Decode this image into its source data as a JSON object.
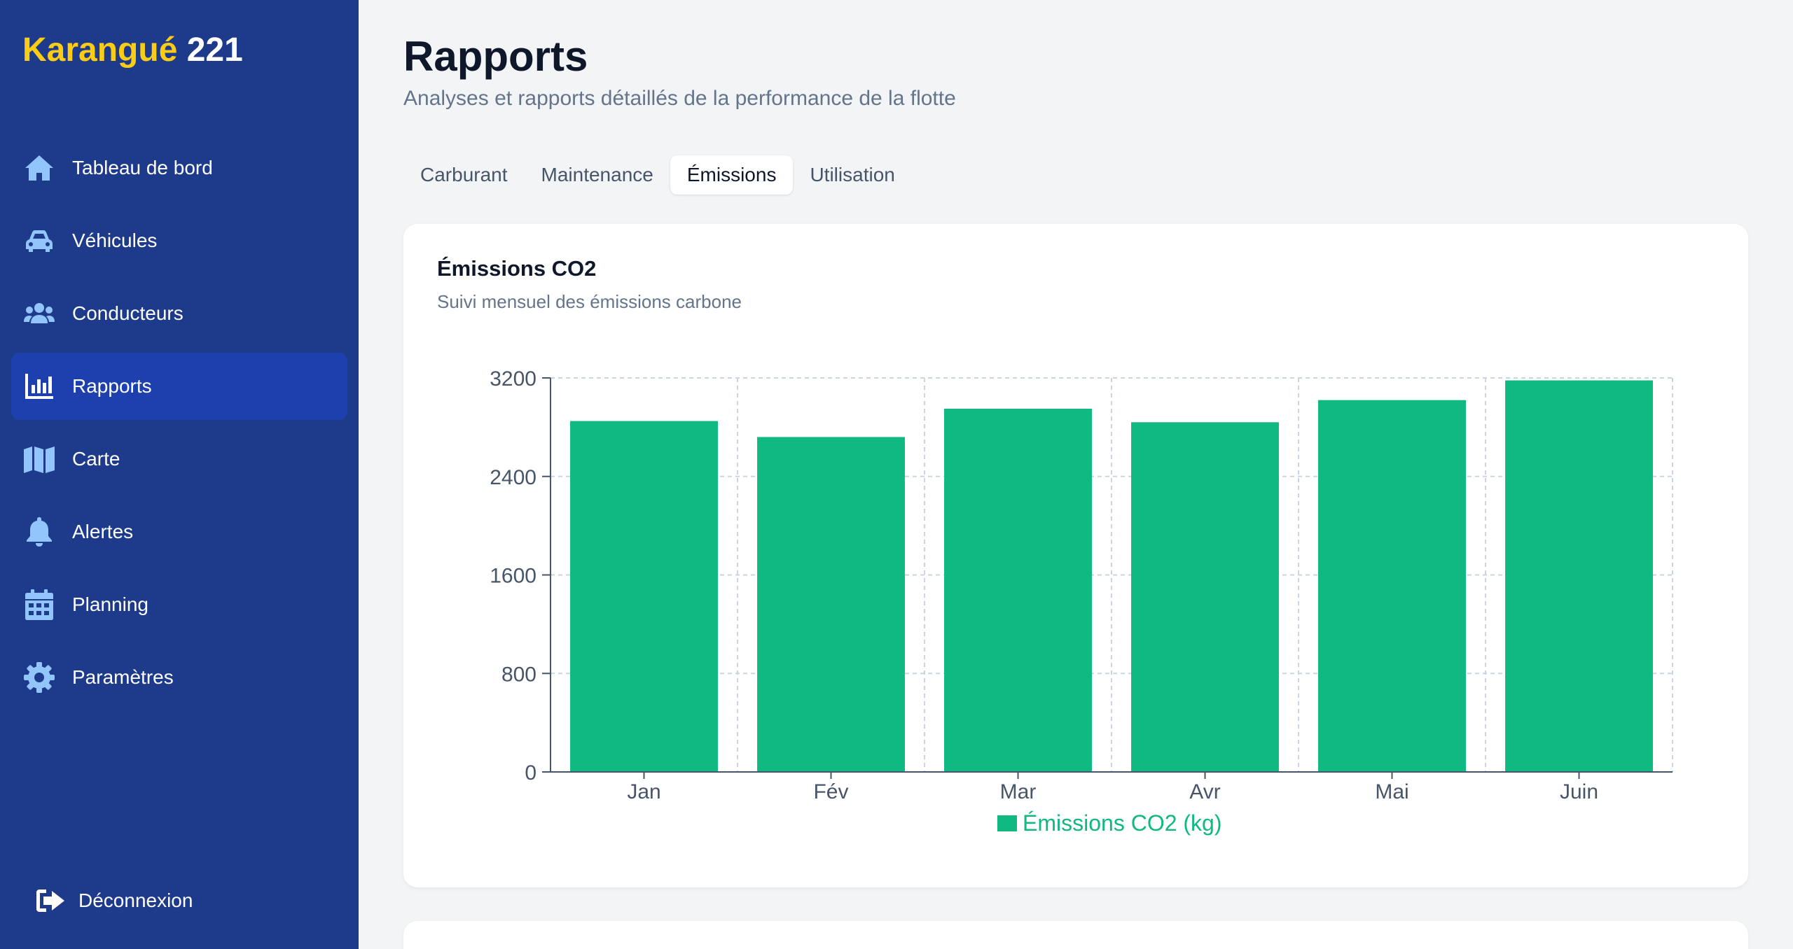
{
  "brand": {
    "part1": "Karangué",
    "part2": "221"
  },
  "sidebar": {
    "items": [
      {
        "label": "Tableau de bord",
        "icon": "home-icon"
      },
      {
        "label": "Véhicules",
        "icon": "car-icon"
      },
      {
        "label": "Conducteurs",
        "icon": "users-icon"
      },
      {
        "label": "Rapports",
        "icon": "chart-bar-icon",
        "active": true
      },
      {
        "label": "Carte",
        "icon": "map-icon"
      },
      {
        "label": "Alertes",
        "icon": "bell-icon"
      },
      {
        "label": "Planning",
        "icon": "calendar-icon"
      },
      {
        "label": "Paramètres",
        "icon": "gear-icon"
      }
    ],
    "logout": {
      "label": "Déconnexion",
      "icon": "logout-icon"
    }
  },
  "header": {
    "title": "Rapports",
    "subtitle": "Analyses et rapports détaillés de la performance de la flotte"
  },
  "tabs": [
    {
      "label": "Carburant"
    },
    {
      "label": "Maintenance"
    },
    {
      "label": "Émissions",
      "active": true
    },
    {
      "label": "Utilisation"
    }
  ],
  "card": {
    "title": "Émissions CO2",
    "subtitle": "Suivi mensuel des émissions carbone"
  },
  "colors": {
    "sidebar": "#1e3a8a",
    "sidebar_active": "#1e40af",
    "brand_accent": "#facc15",
    "icon": "#93c5fd",
    "bar": "#10b981"
  },
  "chart_data": {
    "type": "bar",
    "categories": [
      "Jan",
      "Fév",
      "Mar",
      "Avr",
      "Mai",
      "Juin"
    ],
    "series": [
      {
        "name": "Émissions CO2 (kg)",
        "values": [
          2850,
          2720,
          2950,
          2840,
          3020,
          3180
        ]
      }
    ],
    "ylim": [
      0,
      3200
    ],
    "yticks": [
      0,
      800,
      1600,
      2400,
      3200
    ],
    "grid": true,
    "legend": "bottom"
  }
}
